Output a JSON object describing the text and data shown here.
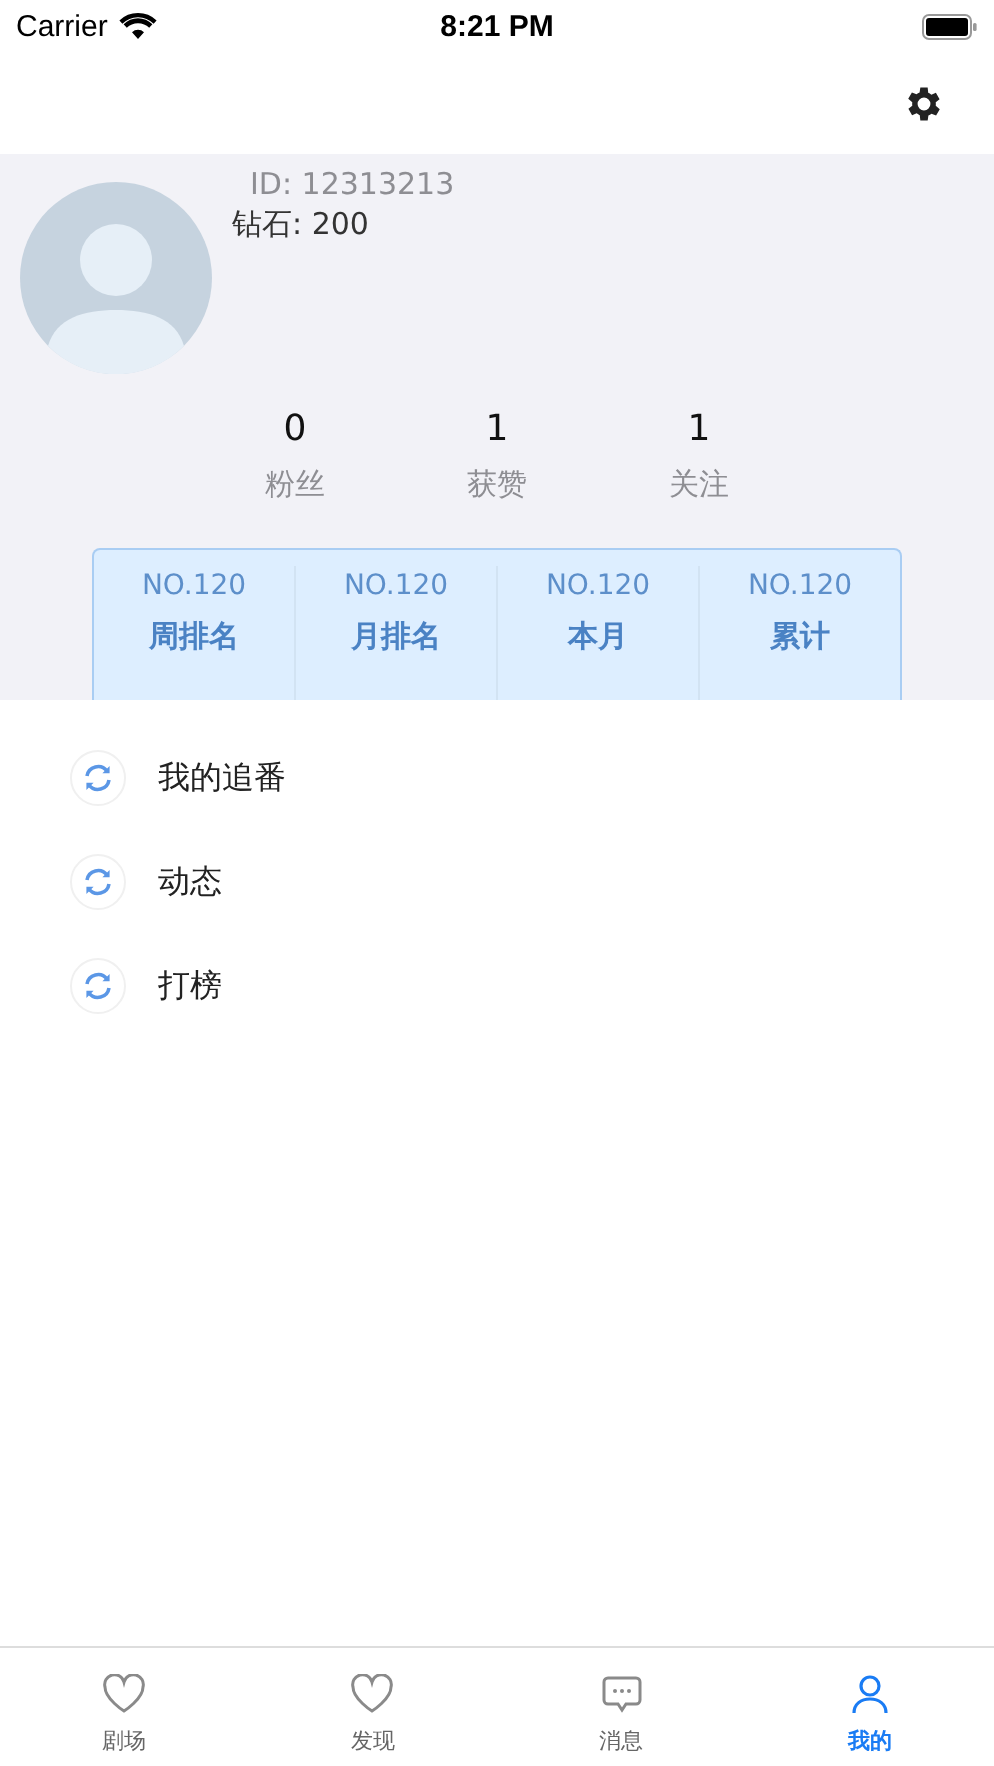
{
  "status_bar": {
    "carrier": "Carrier",
    "time": "8:21 PM"
  },
  "profile": {
    "id": "ID: 12313213",
    "diamonds": "钻石: 200"
  },
  "stats": [
    {
      "value": "0",
      "label": "粉丝"
    },
    {
      "value": "1",
      "label": "获赞"
    },
    {
      "value": "1",
      "label": "关注"
    }
  ],
  "ranks": [
    {
      "value": "NO.120",
      "label": "周排名"
    },
    {
      "value": "NO.120",
      "label": "月排名"
    },
    {
      "value": "NO.120",
      "label": "本月"
    },
    {
      "value": "NO.120",
      "label": "累计"
    }
  ],
  "menu": [
    {
      "label": "我的追番"
    },
    {
      "label": "动态"
    },
    {
      "label": "打榜"
    }
  ],
  "tabs": [
    {
      "label": "剧场",
      "kind": "heart",
      "selected": false
    },
    {
      "label": "发现",
      "kind": "heart",
      "selected": false
    },
    {
      "label": "消息",
      "kind": "chat",
      "selected": false
    },
    {
      "label": "我的",
      "kind": "person",
      "selected": true
    }
  ]
}
